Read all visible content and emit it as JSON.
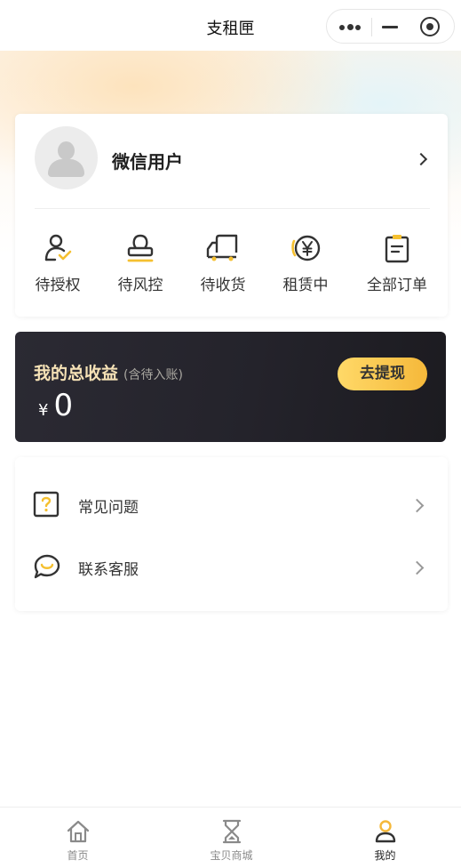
{
  "navbar": {
    "title": "支租匣"
  },
  "colors": {
    "accent": "#f5b83a",
    "accent_light": "#ffd968",
    "dark_card": "#24232b"
  },
  "user": {
    "name": "微信用户"
  },
  "orders": [
    {
      "label": "待授权",
      "icon": "user-check-icon"
    },
    {
      "label": "待风控",
      "icon": "stamp-icon"
    },
    {
      "label": "待收货",
      "icon": "truck-icon"
    },
    {
      "label": "租赁中",
      "icon": "yen-coin-icon"
    },
    {
      "label": "全部订单",
      "icon": "clipboard-icon"
    }
  ],
  "earnings": {
    "title": "我的总收益",
    "subtitle": "(含待入账)",
    "currency": "¥",
    "amount": "0",
    "button": "去提现"
  },
  "menu": [
    {
      "label": "常见问题",
      "icon": "question-icon"
    },
    {
      "label": "联系客服",
      "icon": "chat-icon"
    }
  ],
  "tabbar": [
    {
      "label": "首页",
      "icon": "home-icon"
    },
    {
      "label": "宝贝商城",
      "icon": "hourglass-icon"
    },
    {
      "label": "我的",
      "icon": "user-icon",
      "active": true
    }
  ]
}
